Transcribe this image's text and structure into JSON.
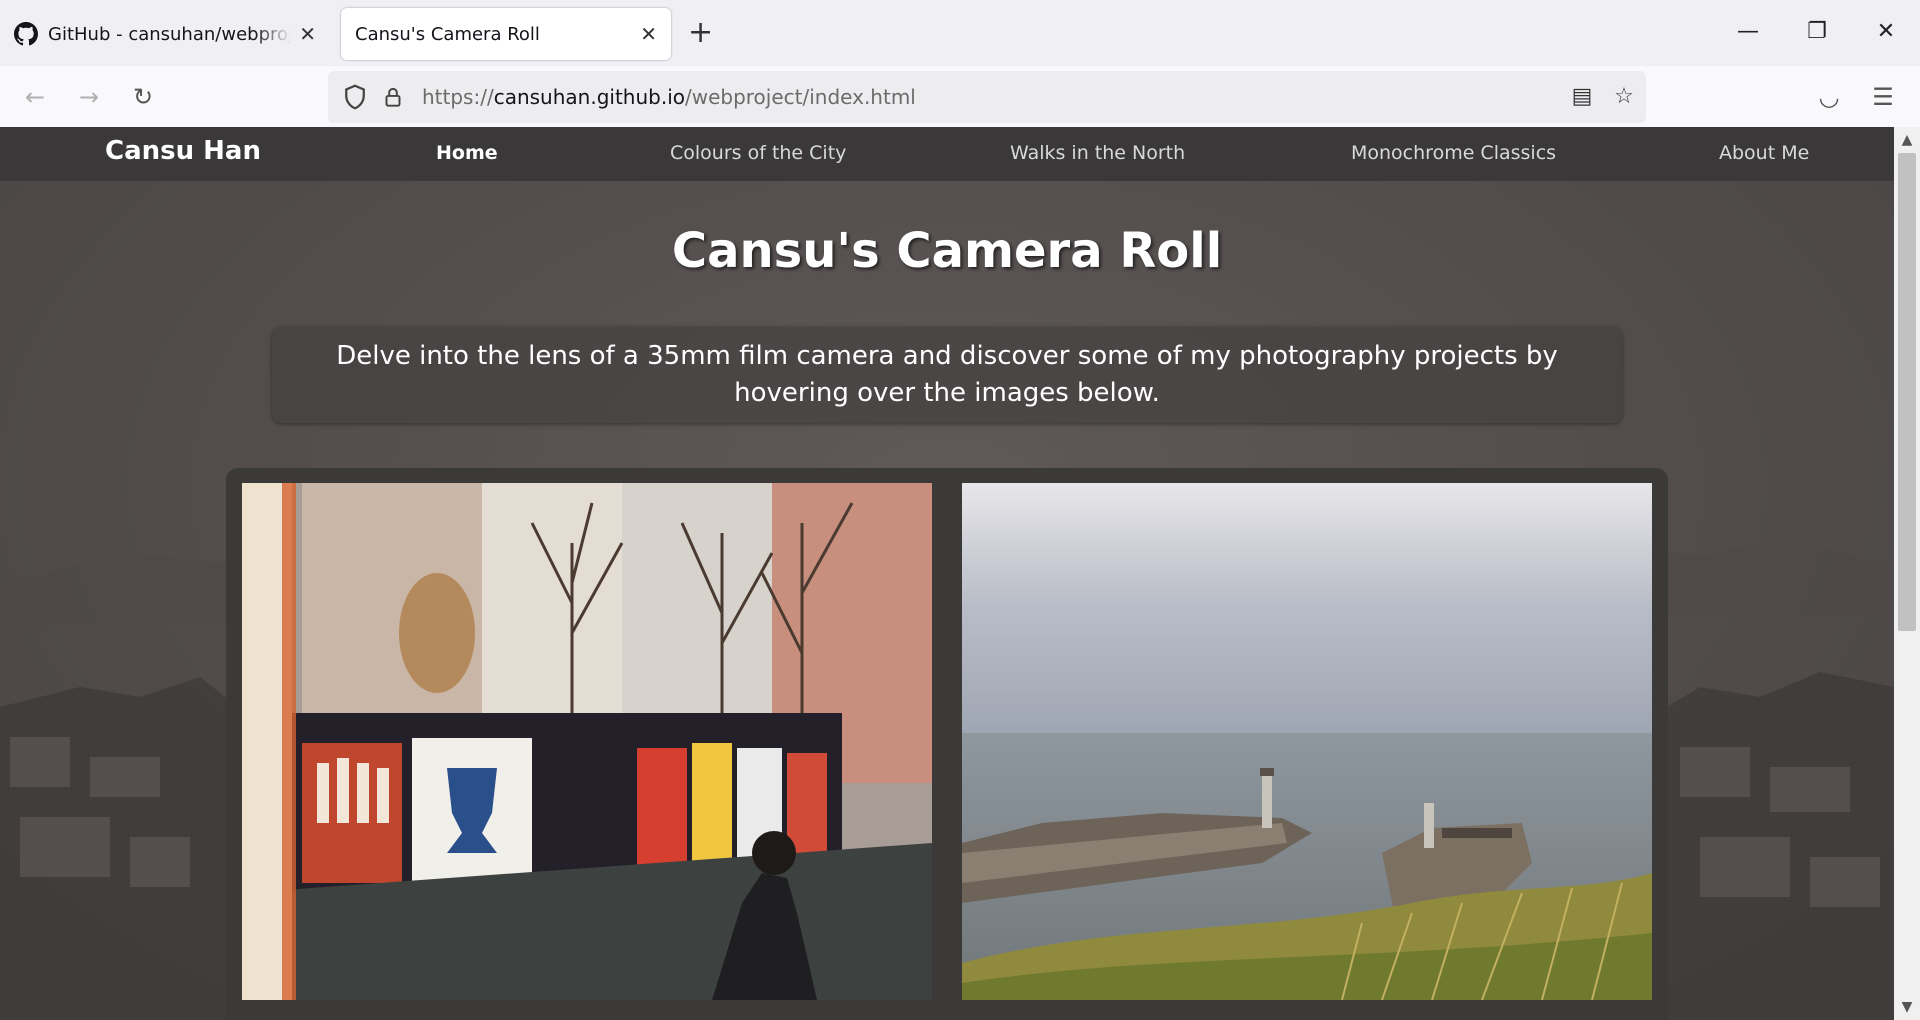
{
  "browser": {
    "tabs": [
      {
        "title": "GitHub - cansuhan/webproject: A",
        "icon": "github-icon"
      },
      {
        "title": "Cansu's Camera Roll",
        "icon": ""
      }
    ],
    "url_prefix": "https://",
    "url_host": "cansuhan.github.io",
    "url_path": "/webproject/index.html",
    "new_tab_glyph": "+"
  },
  "site": {
    "brand": "Cansu Han",
    "nav": [
      {
        "label": "Home",
        "active": true
      },
      {
        "label": "Colours of the City",
        "active": false
      },
      {
        "label": "Walks in the North",
        "active": false
      },
      {
        "label": "Monochrome Classics",
        "active": false
      },
      {
        "label": "About Me",
        "active": false
      }
    ],
    "title": "Cansu's Camera Roll",
    "intro": "Delve into the lens of a 35mm film camera and discover some of my photography projects by hovering over the images below.",
    "gallery": [
      {
        "subject": "street-mural-photo"
      },
      {
        "subject": "harbour-pier-photo"
      }
    ]
  },
  "colors": {
    "site_nav_bg": "#3a3838",
    "gallery_bg": "#3c3939",
    "text_white": "#ffffff"
  }
}
